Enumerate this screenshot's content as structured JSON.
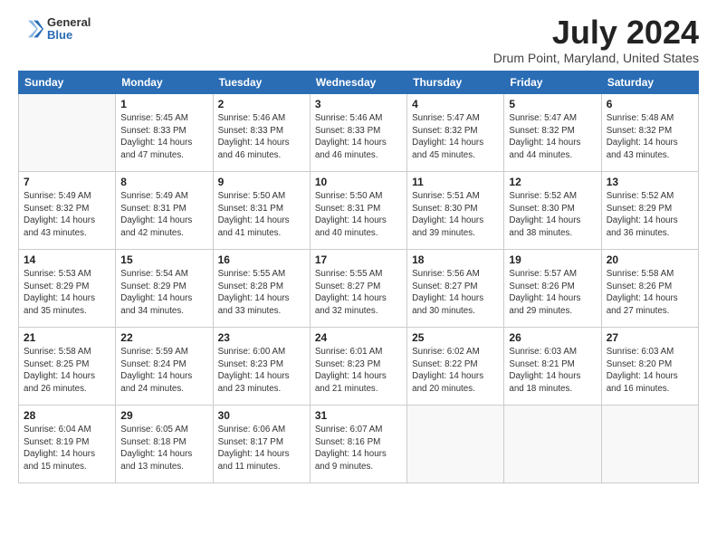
{
  "header": {
    "logo_line1": "General",
    "logo_line2": "Blue",
    "month_year": "July 2024",
    "location": "Drum Point, Maryland, United States"
  },
  "days_of_week": [
    "Sunday",
    "Monday",
    "Tuesday",
    "Wednesday",
    "Thursday",
    "Friday",
    "Saturday"
  ],
  "weeks": [
    [
      {
        "day": "",
        "info": ""
      },
      {
        "day": "1",
        "info": "Sunrise: 5:45 AM\nSunset: 8:33 PM\nDaylight: 14 hours\nand 47 minutes."
      },
      {
        "day": "2",
        "info": "Sunrise: 5:46 AM\nSunset: 8:33 PM\nDaylight: 14 hours\nand 46 minutes."
      },
      {
        "day": "3",
        "info": "Sunrise: 5:46 AM\nSunset: 8:33 PM\nDaylight: 14 hours\nand 46 minutes."
      },
      {
        "day": "4",
        "info": "Sunrise: 5:47 AM\nSunset: 8:32 PM\nDaylight: 14 hours\nand 45 minutes."
      },
      {
        "day": "5",
        "info": "Sunrise: 5:47 AM\nSunset: 8:32 PM\nDaylight: 14 hours\nand 44 minutes."
      },
      {
        "day": "6",
        "info": "Sunrise: 5:48 AM\nSunset: 8:32 PM\nDaylight: 14 hours\nand 43 minutes."
      }
    ],
    [
      {
        "day": "7",
        "info": "Sunrise: 5:49 AM\nSunset: 8:32 PM\nDaylight: 14 hours\nand 43 minutes."
      },
      {
        "day": "8",
        "info": "Sunrise: 5:49 AM\nSunset: 8:31 PM\nDaylight: 14 hours\nand 42 minutes."
      },
      {
        "day": "9",
        "info": "Sunrise: 5:50 AM\nSunset: 8:31 PM\nDaylight: 14 hours\nand 41 minutes."
      },
      {
        "day": "10",
        "info": "Sunrise: 5:50 AM\nSunset: 8:31 PM\nDaylight: 14 hours\nand 40 minutes."
      },
      {
        "day": "11",
        "info": "Sunrise: 5:51 AM\nSunset: 8:30 PM\nDaylight: 14 hours\nand 39 minutes."
      },
      {
        "day": "12",
        "info": "Sunrise: 5:52 AM\nSunset: 8:30 PM\nDaylight: 14 hours\nand 38 minutes."
      },
      {
        "day": "13",
        "info": "Sunrise: 5:52 AM\nSunset: 8:29 PM\nDaylight: 14 hours\nand 36 minutes."
      }
    ],
    [
      {
        "day": "14",
        "info": "Sunrise: 5:53 AM\nSunset: 8:29 PM\nDaylight: 14 hours\nand 35 minutes."
      },
      {
        "day": "15",
        "info": "Sunrise: 5:54 AM\nSunset: 8:29 PM\nDaylight: 14 hours\nand 34 minutes."
      },
      {
        "day": "16",
        "info": "Sunrise: 5:55 AM\nSunset: 8:28 PM\nDaylight: 14 hours\nand 33 minutes."
      },
      {
        "day": "17",
        "info": "Sunrise: 5:55 AM\nSunset: 8:27 PM\nDaylight: 14 hours\nand 32 minutes."
      },
      {
        "day": "18",
        "info": "Sunrise: 5:56 AM\nSunset: 8:27 PM\nDaylight: 14 hours\nand 30 minutes."
      },
      {
        "day": "19",
        "info": "Sunrise: 5:57 AM\nSunset: 8:26 PM\nDaylight: 14 hours\nand 29 minutes."
      },
      {
        "day": "20",
        "info": "Sunrise: 5:58 AM\nSunset: 8:26 PM\nDaylight: 14 hours\nand 27 minutes."
      }
    ],
    [
      {
        "day": "21",
        "info": "Sunrise: 5:58 AM\nSunset: 8:25 PM\nDaylight: 14 hours\nand 26 minutes."
      },
      {
        "day": "22",
        "info": "Sunrise: 5:59 AM\nSunset: 8:24 PM\nDaylight: 14 hours\nand 24 minutes."
      },
      {
        "day": "23",
        "info": "Sunrise: 6:00 AM\nSunset: 8:23 PM\nDaylight: 14 hours\nand 23 minutes."
      },
      {
        "day": "24",
        "info": "Sunrise: 6:01 AM\nSunset: 8:23 PM\nDaylight: 14 hours\nand 21 minutes."
      },
      {
        "day": "25",
        "info": "Sunrise: 6:02 AM\nSunset: 8:22 PM\nDaylight: 14 hours\nand 20 minutes."
      },
      {
        "day": "26",
        "info": "Sunrise: 6:03 AM\nSunset: 8:21 PM\nDaylight: 14 hours\nand 18 minutes."
      },
      {
        "day": "27",
        "info": "Sunrise: 6:03 AM\nSunset: 8:20 PM\nDaylight: 14 hours\nand 16 minutes."
      }
    ],
    [
      {
        "day": "28",
        "info": "Sunrise: 6:04 AM\nSunset: 8:19 PM\nDaylight: 14 hours\nand 15 minutes."
      },
      {
        "day": "29",
        "info": "Sunrise: 6:05 AM\nSunset: 8:18 PM\nDaylight: 14 hours\nand 13 minutes."
      },
      {
        "day": "30",
        "info": "Sunrise: 6:06 AM\nSunset: 8:17 PM\nDaylight: 14 hours\nand 11 minutes."
      },
      {
        "day": "31",
        "info": "Sunrise: 6:07 AM\nSunset: 8:16 PM\nDaylight: 14 hours\nand 9 minutes."
      },
      {
        "day": "",
        "info": ""
      },
      {
        "day": "",
        "info": ""
      },
      {
        "day": "",
        "info": ""
      }
    ]
  ]
}
